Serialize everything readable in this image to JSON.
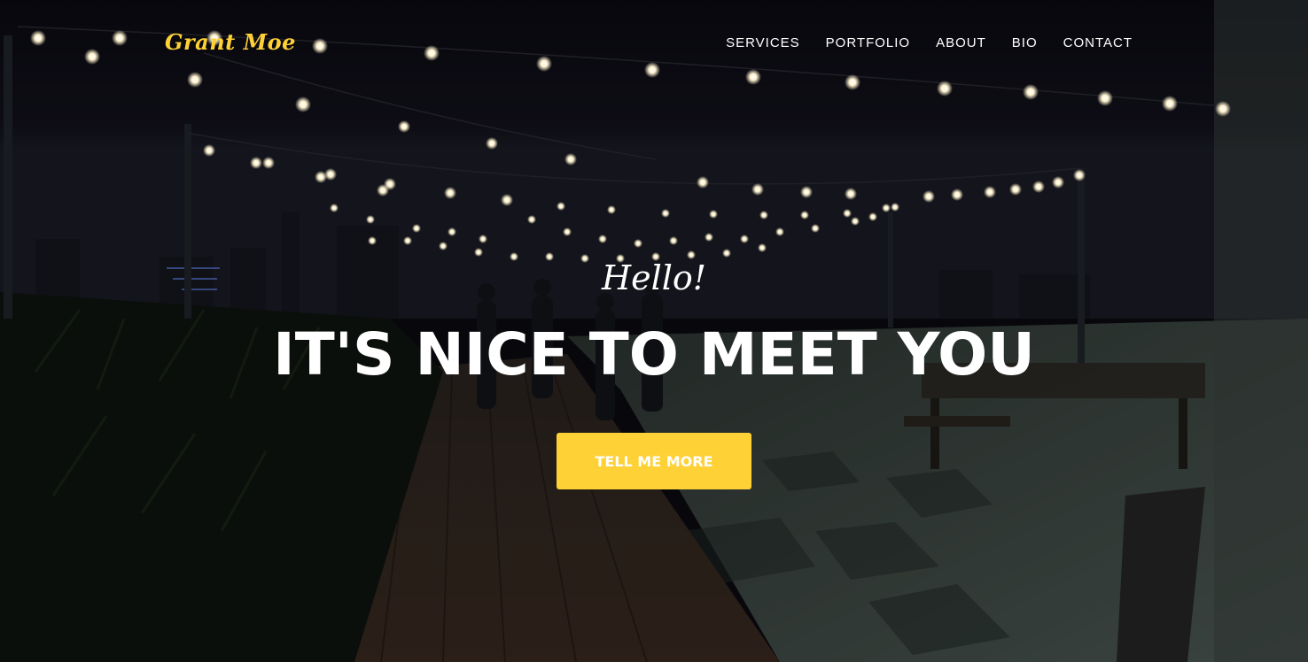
{
  "nav": {
    "brand": "Grant Moe",
    "links": [
      "SERVICES",
      "PORTFOLIO",
      "ABOUT",
      "BIO",
      "CONTACT"
    ]
  },
  "intro": {
    "lead_in": "Hello!",
    "heading": "IT'S NICE TO MEET YOU",
    "button_label": "TELL ME MORE"
  },
  "colors": {
    "accent": "#fed136",
    "text": "#ffffff",
    "background": "#0b0b10"
  },
  "background_photo": "night rooftop terrace with string lights, people standing, city skyline"
}
